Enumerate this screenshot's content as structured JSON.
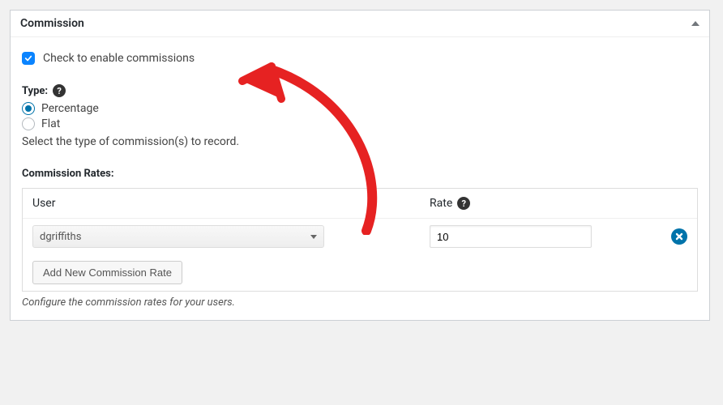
{
  "panel": {
    "title": "Commission"
  },
  "enable": {
    "label": "Check to enable commissions",
    "checked": true
  },
  "type": {
    "label": "Type:",
    "options": {
      "percentage": "Percentage",
      "flat": "Flat"
    },
    "selected": "percentage",
    "help": "Select the type of commission(s) to record."
  },
  "rates": {
    "heading": "Commission Rates:",
    "columns": {
      "user": "User",
      "rate": "Rate"
    },
    "rows": [
      {
        "user": "dgriffiths",
        "rate": "10"
      }
    ],
    "add_button": "Add New Commission Rate",
    "footer": "Configure the commission rates for your users."
  }
}
